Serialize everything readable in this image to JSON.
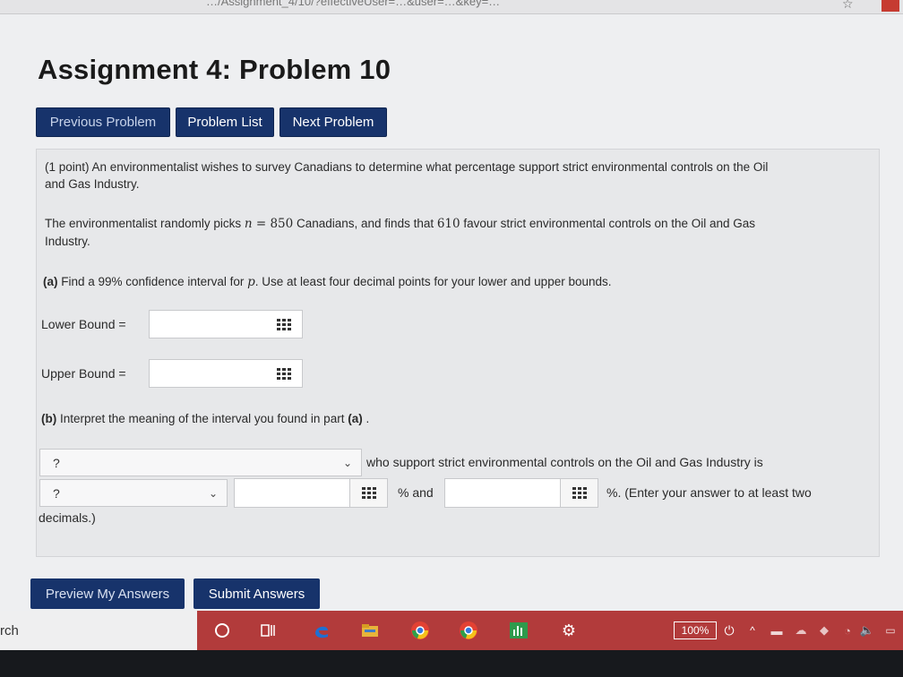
{
  "browser": {
    "url_fragment": "…/Assignment_4/10/?effectiveUser=…&user=…&key=…",
    "bookmark_icon": "star-icon"
  },
  "title": "Assignment 4: Problem 10",
  "nav": {
    "previous": "Previous Problem",
    "list": "Problem List",
    "next": "Next Problem"
  },
  "problem": {
    "intro_line1": "(1 point) An environmentalist wishes to survey Canadians to determine what percentage support strict environmental controls on the Oil",
    "intro_line2": "and Gas Industry.",
    "sample_a": "The environmentalist randomly picks ",
    "n_var": "n",
    "eq": " = ",
    "n_val": "850",
    "sample_b": " Canadians, and finds that ",
    "x_val": "610",
    "sample_c": " favour strict environmental controls on the Oil and Gas",
    "sample_line2": "Industry.",
    "part_a_tag": "(a)",
    "part_a_text1": " Find a 99% confidence interval for ",
    "p_var": "p",
    "part_a_text2": ". Use at least four decimal points for your lower and upper bounds.",
    "lower_label": "Lower Bound =",
    "lower_value": "",
    "upper_label": "Upper Bound =",
    "upper_value": "",
    "part_b_tag": "(b)",
    "part_b_text1": " Interpret the meaning of the interval you found in part ",
    "part_b_ref": "(a)",
    "part_b_text2": " .",
    "select1_value": "?",
    "sentence_1": "who support strict environmental controls on the Oil and Gas Industry is",
    "select2_value": "?",
    "pct_and": "% and",
    "pct_end": "%. (Enter your answer to at least two",
    "decimals": "decimals.)",
    "box1_value": "",
    "box2_value": ""
  },
  "actions": {
    "preview": "Preview My Answers",
    "submit": "Submit Answers"
  },
  "taskbar": {
    "search_fragment": "rch",
    "zoom": "100%"
  }
}
